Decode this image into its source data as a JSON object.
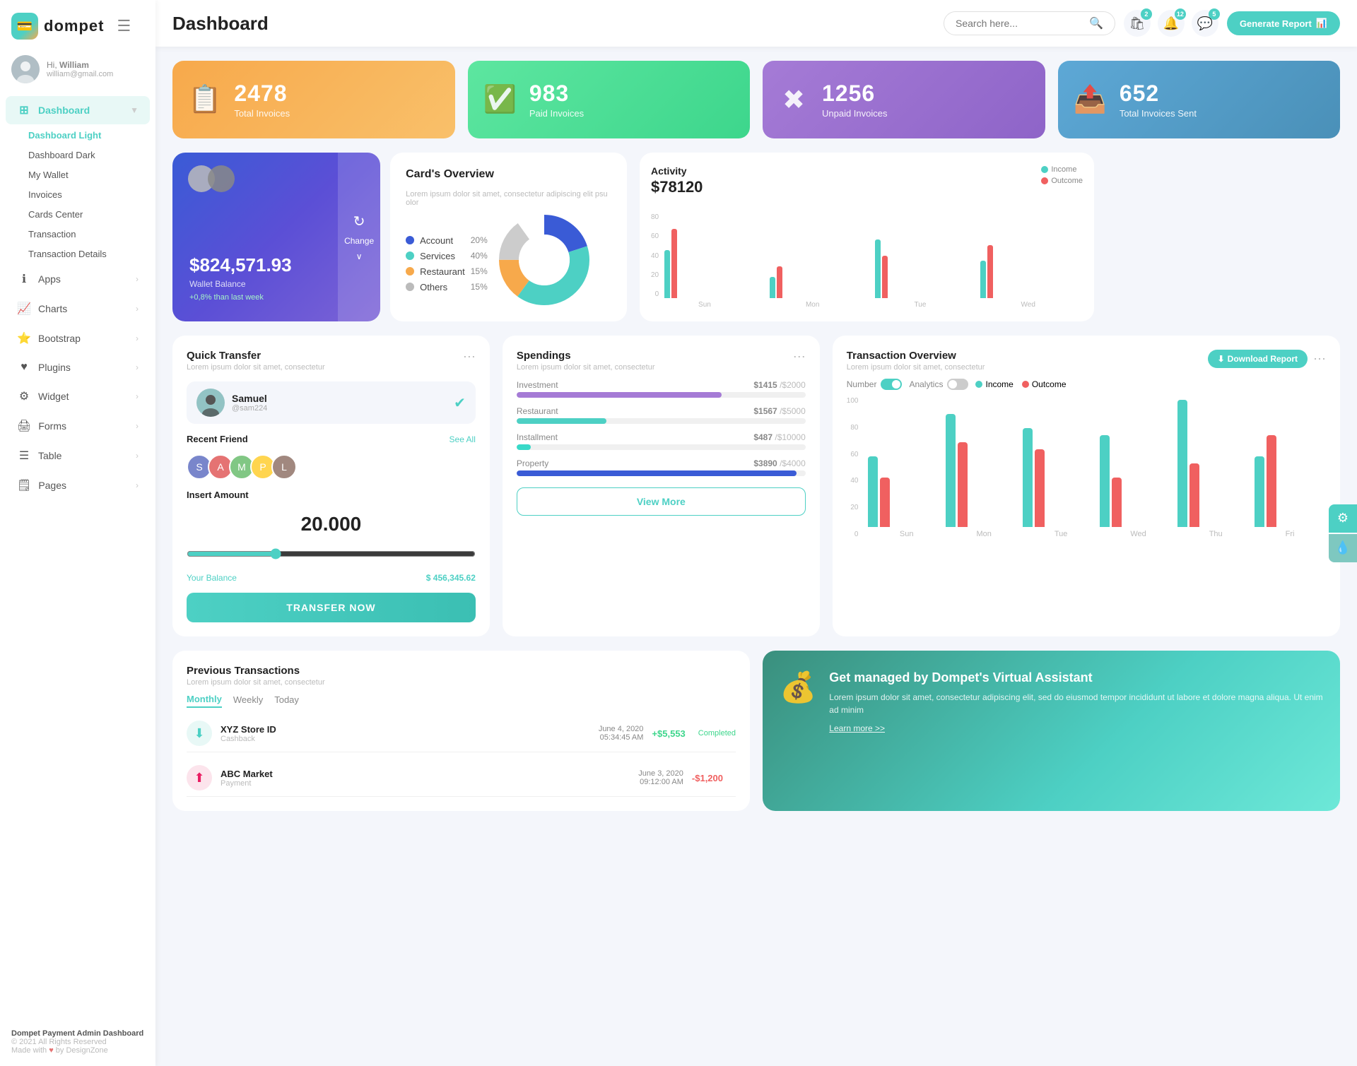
{
  "logo": {
    "text": "dompet"
  },
  "user": {
    "greeting": "Hi,",
    "name": "William",
    "email": "william@gmail.com"
  },
  "nav": {
    "main_items": [
      {
        "id": "dashboard",
        "label": "Dashboard",
        "icon": "⊞",
        "active": true,
        "has_arrow": true
      },
      {
        "id": "apps",
        "label": "Apps",
        "icon": "ℹ",
        "active": false,
        "has_arrow": true
      },
      {
        "id": "charts",
        "label": "Charts",
        "icon": "📈",
        "active": false,
        "has_arrow": true
      },
      {
        "id": "bootstrap",
        "label": "Bootstrap",
        "icon": "⭐",
        "active": false,
        "has_arrow": true
      },
      {
        "id": "plugins",
        "label": "Plugins",
        "icon": "♥",
        "active": false,
        "has_arrow": true
      },
      {
        "id": "widget",
        "label": "Widget",
        "icon": "⚙",
        "active": false,
        "has_arrow": true
      },
      {
        "id": "forms",
        "label": "Forms",
        "icon": "🖨",
        "active": false,
        "has_arrow": true
      },
      {
        "id": "table",
        "label": "Table",
        "icon": "☰",
        "active": false,
        "has_arrow": true
      },
      {
        "id": "pages",
        "label": "Pages",
        "icon": "🗒",
        "active": false,
        "has_arrow": true
      }
    ],
    "sub_items": [
      {
        "label": "Dashboard Light",
        "active": true
      },
      {
        "label": "Dashboard Dark",
        "active": false
      },
      {
        "label": "My Wallet",
        "active": false
      },
      {
        "label": "Invoices",
        "active": false
      },
      {
        "label": "Cards Center",
        "active": false
      },
      {
        "label": "Transaction",
        "active": false
      },
      {
        "label": "Transaction Details",
        "active": false
      }
    ]
  },
  "header": {
    "title": "Dashboard",
    "search_placeholder": "Search here...",
    "icons": [
      {
        "id": "bag",
        "badge": "2"
      },
      {
        "id": "bell",
        "badge": "12"
      },
      {
        "id": "chat",
        "badge": "5"
      }
    ],
    "generate_btn": "Generate Report"
  },
  "stat_cards": [
    {
      "id": "total-invoices",
      "number": "2478",
      "label": "Total Invoices",
      "color": "orange",
      "icon": "📋"
    },
    {
      "id": "paid-invoices",
      "number": "983",
      "label": "Paid Invoices",
      "color": "green",
      "icon": "✅"
    },
    {
      "id": "unpaid-invoices",
      "number": "1256",
      "label": "Unpaid Invoices",
      "color": "purple",
      "icon": "✖"
    },
    {
      "id": "total-sent",
      "number": "652",
      "label": "Total Invoices Sent",
      "color": "blue",
      "icon": "📤"
    }
  ],
  "wallet": {
    "amount": "$824,571.93",
    "label": "Wallet Balance",
    "change": "+0,8% than last week",
    "change_btn": "Change"
  },
  "cards_overview": {
    "title": "Card's Overview",
    "desc": "Lorem ipsum dolor sit amet, consectetur adipiscing elit psu olor",
    "items": [
      {
        "label": "Account",
        "color": "#3a5bd6",
        "pct": "20%"
      },
      {
        "label": "Services",
        "color": "#4dd0c4",
        "pct": "40%"
      },
      {
        "label": "Restaurant",
        "color": "#f7a94b",
        "pct": "15%"
      },
      {
        "label": "Others",
        "color": "#bbb",
        "pct": "15%"
      }
    ]
  },
  "activity": {
    "title": "Activity",
    "amount": "$78120",
    "legend": [
      {
        "label": "Income",
        "color": "#4dd0c4"
      },
      {
        "label": "Outcome",
        "color": "#f06060"
      }
    ],
    "bars": [
      {
        "day": "Sun",
        "income": 45,
        "outcome": 65
      },
      {
        "day": "Mon",
        "income": 20,
        "outcome": 30
      },
      {
        "day": "Tue",
        "income": 55,
        "outcome": 40
      },
      {
        "day": "Wed",
        "income": 35,
        "outcome": 50
      }
    ],
    "y_labels": [
      "80",
      "60",
      "40",
      "20",
      "0"
    ]
  },
  "quick_transfer": {
    "title": "Quick Transfer",
    "desc": "Lorem ipsum dolor sit amet, consectetur",
    "user": {
      "name": "Samuel",
      "id": "@sam224"
    },
    "recent_friend_label": "Recent Friend",
    "see_all": "See All",
    "friends": [
      "S",
      "A",
      "M",
      "P",
      "L"
    ],
    "amount_label": "Insert Amount",
    "amount": "20.000",
    "balance_label": "Your Balance",
    "balance": "$ 456,345.62",
    "transfer_btn": "TRANSFER NOW"
  },
  "spendings": {
    "title": "Spendings",
    "desc": "Lorem ipsum dolor sit amet, consectetur",
    "items": [
      {
        "label": "Investment",
        "amount": "$1415",
        "total": "/$2000",
        "pct": 71,
        "color": "#a57bd6"
      },
      {
        "label": "Restaurant",
        "amount": "$1567",
        "total": "/$5000",
        "pct": 31,
        "color": "#4dd0c4"
      },
      {
        "label": "Installment",
        "amount": "$487",
        "total": "/$10000",
        "pct": 5,
        "color": "#38d9c8"
      },
      {
        "label": "Property",
        "amount": "$3890",
        "total": "/$4000",
        "pct": 97,
        "color": "#3a5bd6"
      }
    ],
    "view_more_btn": "View More"
  },
  "transaction_overview": {
    "title": "Transaction Overview",
    "desc": "Lorem ipsum dolor sit amet, consectetur",
    "toggle1_label": "Number",
    "toggle1_on": true,
    "toggle2_label": "Analytics",
    "toggle2_on": false,
    "download_btn": "Download Report",
    "legend": [
      {
        "label": "Income",
        "color": "#4dd0c4"
      },
      {
        "label": "Outcome",
        "color": "#f06060"
      }
    ],
    "bars": [
      {
        "day": "Sun",
        "income": 50,
        "outcome": 35
      },
      {
        "day": "Mon",
        "income": 80,
        "outcome": 60
      },
      {
        "day": "Tue",
        "income": 70,
        "outcome": 55
      },
      {
        "day": "Wed",
        "income": 65,
        "outcome": 35
      },
      {
        "day": "Thu",
        "income": 90,
        "outcome": 45
      },
      {
        "day": "Fri",
        "income": 50,
        "outcome": 65
      }
    ],
    "y_labels": [
      "100",
      "80",
      "60",
      "40",
      "20",
      "0"
    ]
  },
  "prev_transactions": {
    "title": "Previous Transactions",
    "desc": "Lorem ipsum dolor sit amet, consectetur",
    "tabs": [
      "Monthly",
      "Weekly",
      "Today"
    ],
    "active_tab": "Monthly",
    "rows": [
      {
        "name": "XYZ Store ID",
        "type": "Cashback",
        "date": "June 4, 2020",
        "time": "05:34:45 AM",
        "amount": "+$5,553",
        "positive": true,
        "status": "Completed",
        "icon": "cashback"
      },
      {
        "name": "ABC Market",
        "type": "Payment",
        "date": "June 3, 2020",
        "time": "09:12:00 AM",
        "amount": "-$1,200",
        "positive": false,
        "status": "",
        "icon": "pink"
      }
    ]
  },
  "assistant": {
    "title": "Get managed by Dompet's Virtual Assistant",
    "desc": "Lorem ipsum dolor sit amet, consectetur adipiscing elit, sed do eiusmod tempor incididunt ut labore et dolore magna aliqua. Ut enim ad minim",
    "link": "Learn more >>"
  },
  "footer": {
    "brand": "Dompet Payment Admin Dashboard",
    "copyright": "© 2021 All Rights Reserved",
    "made_with": "Made with",
    "by": "by DesignZone"
  },
  "colors": {
    "primary": "#4dd0c4",
    "orange": "#f7a94b",
    "green": "#3dd68c",
    "purple": "#a57bd6",
    "blue": "#5da8d6"
  }
}
